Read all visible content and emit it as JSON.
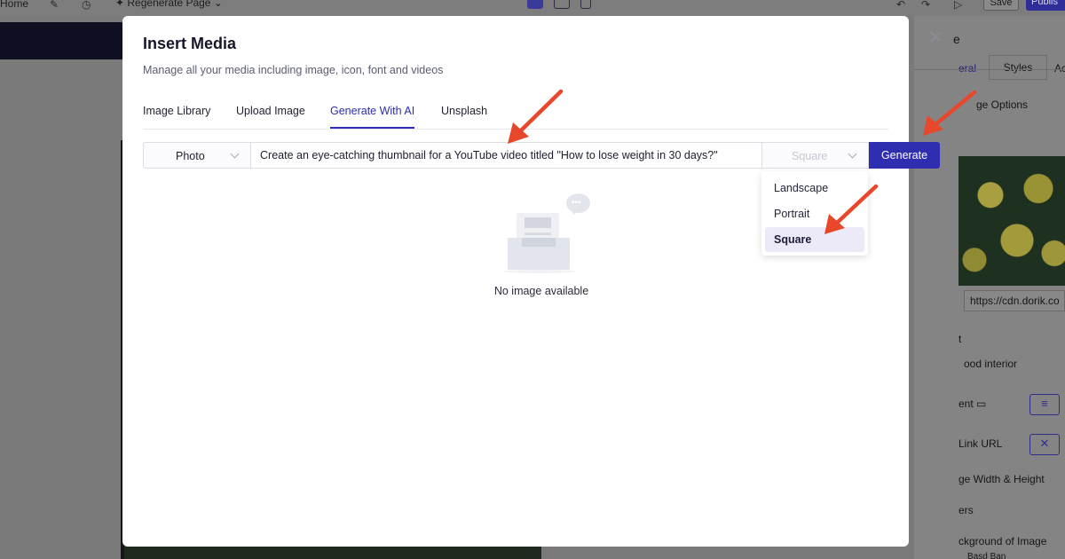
{
  "topbar": {
    "home_label": "Home",
    "regenerate_label": "Regenerate Page",
    "save_label": "Save",
    "publish_label": "Publis"
  },
  "right_panel": {
    "title_fragment": "e",
    "tab_general": "eral",
    "tab_styles": "Styles",
    "tab_other": "Ac",
    "image_options": "ge Options",
    "url_value": "https://cdn.dorik.co",
    "alt_fragment": "t",
    "alt_value": "ood interior",
    "alignment_label": "ent",
    "link_url_label": "Link URL",
    "width_height_label": "ge Width & Height",
    "filters_label": "ers",
    "background_label": "ckground of Image",
    "bottom_fragment": "Basd Ban"
  },
  "modal": {
    "title": "Insert Media",
    "subtitle": "Manage all your media including image, icon, font and videos",
    "tabs": [
      {
        "label": "Image Library"
      },
      {
        "label": "Upload Image"
      },
      {
        "label": "Generate With AI"
      },
      {
        "label": "Unsplash"
      }
    ],
    "active_tab": "Generate With AI",
    "generator": {
      "type_value": "Photo",
      "prompt_value": "Create an eye-catching thumbnail for a YouTube video titled \"How to lose weight in 30 days?\"",
      "aspect_value": "Square",
      "generate_label": "Generate",
      "aspect_options": [
        {
          "label": "Landscape"
        },
        {
          "label": "Portrait"
        },
        {
          "label": "Square"
        }
      ],
      "selected_option": "Square"
    },
    "empty_state": {
      "message": "No image available",
      "dots": "•••"
    }
  },
  "colors": {
    "accent": "#2f2db0",
    "overlay_gray": "#7a7a7a",
    "annotation_arrow": "#e8472c",
    "selected_option_bg": "#eceaf8"
  },
  "icons": {
    "close": "close-icon",
    "chevron": "chevron-down-icon",
    "empty_state": "empty-inbox-illustration",
    "arrows": "annotation-arrow"
  }
}
